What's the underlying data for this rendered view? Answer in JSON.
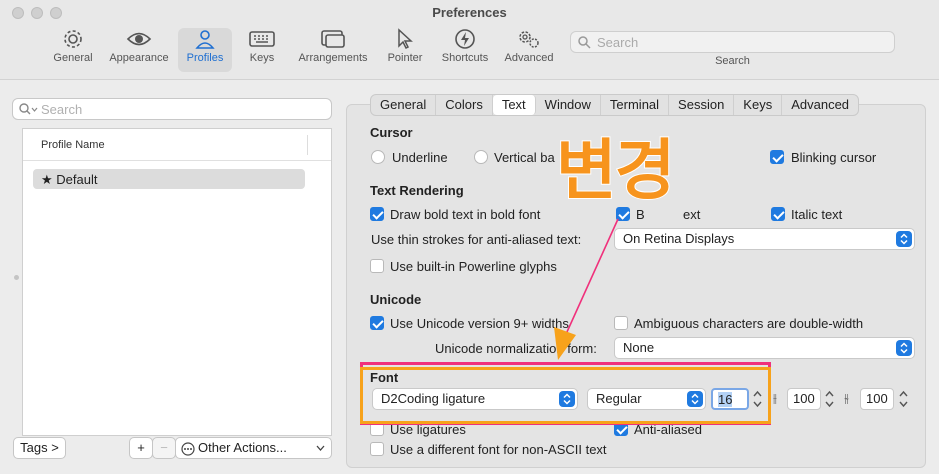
{
  "window": {
    "title": "Preferences"
  },
  "toolbar": {
    "items": [
      {
        "label": "General",
        "icon": "gear-icon"
      },
      {
        "label": "Appearance",
        "icon": "eye-icon"
      },
      {
        "label": "Profiles",
        "icon": "person-icon",
        "active": true
      },
      {
        "label": "Keys",
        "icon": "keyboard-icon"
      },
      {
        "label": "Arrangements",
        "icon": "windows-icon"
      },
      {
        "label": "Pointer",
        "icon": "pointer-icon"
      },
      {
        "label": "Shortcuts",
        "icon": "bolt-icon"
      },
      {
        "label": "Advanced",
        "icon": "gears-icon"
      }
    ],
    "search_placeholder": "Search",
    "search_label": "Search"
  },
  "left": {
    "search_placeholder": "Search",
    "column_header": "Profile Name",
    "profiles": [
      "★ Default"
    ],
    "tags_button": "Tags >",
    "add_button": "+",
    "remove_button": "−",
    "other_actions": "Other Actions..."
  },
  "tabs": [
    "General",
    "Colors",
    "Text",
    "Window",
    "Terminal",
    "Session",
    "Keys",
    "Advanced"
  ],
  "active_tab": "Text",
  "cursor": {
    "heading": "Cursor",
    "underline": "Underline",
    "vertical_bar": "Vertical ba",
    "blinking": "Blinking cursor"
  },
  "text_rendering": {
    "heading": "Text Rendering",
    "bold": "Draw bold text in bold font",
    "bright_partial": "B",
    "bright_rest": "ext",
    "italic": "Italic text",
    "thin_strokes_label": "Use thin strokes for anti-aliased text:",
    "thin_strokes_value": "On Retina Displays",
    "powerline": "Use built-in Powerline glyphs"
  },
  "unicode": {
    "heading": "Unicode",
    "version": "Use Unicode version 9+ widths",
    "ambiguous": "Ambiguous characters are double-width",
    "normalization_label": "Unicode normalization form:",
    "normalization_value": "None"
  },
  "font": {
    "heading": "Font",
    "family": "D2Coding ligature",
    "style": "Regular",
    "size": "16",
    "h_spacing": "100",
    "v_spacing": "100",
    "ligatures": "Use ligatures",
    "anti_aliased": "Anti-aliased",
    "non_ascii": "Use a different font for non-ASCII text"
  },
  "annotation": {
    "text": "변경",
    "color": "#f7941d",
    "box_color": "#f0307b"
  },
  "colors": {
    "accent": "#1f7ae0",
    "orange": "#f7a21b",
    "pink": "#f0307b"
  }
}
